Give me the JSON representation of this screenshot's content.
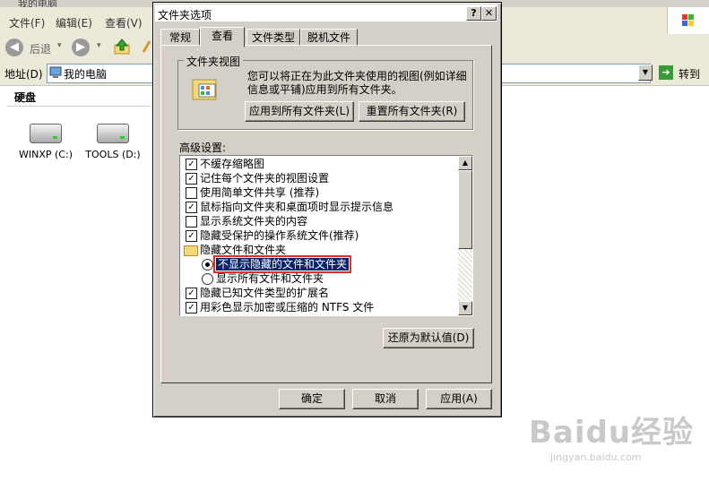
{
  "explorer": {
    "title": "我的电脑",
    "menu": [
      "文件(F)",
      "编辑(E)",
      "查看(V)"
    ],
    "toolbar": {
      "back_label": "后退"
    },
    "address": {
      "label": "地址(D)",
      "value": "我的电脑",
      "go_label": "转到"
    },
    "section_header": "硬盘",
    "drives": [
      {
        "label": "WINXP (C:)"
      },
      {
        "label": "TOOLS (D:)"
      }
    ]
  },
  "dialog": {
    "title": "文件夹选项",
    "help_glyph": "?",
    "close_glyph": "✕",
    "tabs": [
      "常规",
      "查看",
      "文件类型",
      "脱机文件"
    ],
    "active_tab": "查看",
    "folder_views": {
      "group_label": "文件夹视图",
      "description": "您可以将正在为此文件夹使用的视图(例如详细信息或平铺)应用到所有文件夹。",
      "apply_all_button": "应用到所有文件夹(L)",
      "reset_all_button": "重置所有文件夹(R)"
    },
    "advanced": {
      "label": "高级设置:",
      "items": [
        {
          "kind": "checkbox",
          "checked": true,
          "label": "不缓存缩略图"
        },
        {
          "kind": "checkbox",
          "checked": true,
          "label": "记住每个文件夹的视图设置"
        },
        {
          "kind": "checkbox",
          "checked": false,
          "label": "使用简单文件共享 (推荐)"
        },
        {
          "kind": "checkbox",
          "checked": true,
          "label": "鼠标指向文件夹和桌面项时显示提示信息"
        },
        {
          "kind": "checkbox",
          "checked": false,
          "label": "显示系统文件夹的内容"
        },
        {
          "kind": "checkbox",
          "checked": true,
          "label": "隐藏受保护的操作系统文件(推荐)"
        },
        {
          "kind": "folder",
          "label": "隐藏文件和文件夹"
        },
        {
          "kind": "radio",
          "checked": true,
          "selected": true,
          "label": "不显示隐藏的文件和文件夹"
        },
        {
          "kind": "radio",
          "checked": false,
          "label": "显示所有文件和文件夹"
        },
        {
          "kind": "checkbox",
          "checked": true,
          "label": "隐藏已知文件类型的扩展名"
        },
        {
          "kind": "checkbox",
          "checked": true,
          "label": "用彩色显示加密或压缩的 NTFS 文件"
        }
      ],
      "restore_button": "还原为默认值(D)"
    },
    "ok_button": "确定",
    "cancel_button": "取消",
    "apply_button": "应用(A)"
  },
  "watermark": {
    "brand": "Baidu经验",
    "url": "jingyan.baidu.com"
  },
  "colors": {
    "selection": "#0a246a",
    "highlight_box": "#e0301e",
    "dialog_face": "#d4d0c8"
  }
}
